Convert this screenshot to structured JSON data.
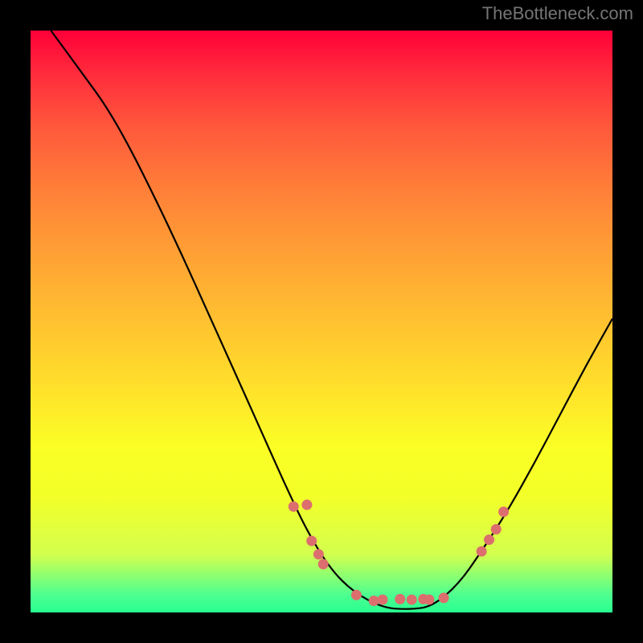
{
  "source_label": "TheBottleneck.com",
  "chart_data": {
    "type": "line",
    "title": "",
    "xlabel": "",
    "ylabel": "",
    "xlim": [
      0,
      100
    ],
    "ylim": [
      0,
      100
    ],
    "curve": [
      {
        "x": 3.5,
        "y": 100
      },
      {
        "x": 9.0,
        "y": 92.5
      },
      {
        "x": 13.0,
        "y": 87.0
      },
      {
        "x": 17.0,
        "y": 80.0
      },
      {
        "x": 21.5,
        "y": 71.0
      },
      {
        "x": 26.0,
        "y": 61.5
      },
      {
        "x": 30.5,
        "y": 51.5
      },
      {
        "x": 35.0,
        "y": 41.5
      },
      {
        "x": 39.5,
        "y": 31.5
      },
      {
        "x": 43.5,
        "y": 22.5
      },
      {
        "x": 47.5,
        "y": 14.0
      },
      {
        "x": 51.5,
        "y": 7.5
      },
      {
        "x": 55.5,
        "y": 3.5
      },
      {
        "x": 60.5,
        "y": 0.8
      },
      {
        "x": 65.0,
        "y": 0.5
      },
      {
        "x": 69.0,
        "y": 1.0
      },
      {
        "x": 73.5,
        "y": 4.8
      },
      {
        "x": 77.5,
        "y": 10.5
      },
      {
        "x": 82.0,
        "y": 17.5
      },
      {
        "x": 86.5,
        "y": 25.5
      },
      {
        "x": 91.0,
        "y": 34.0
      },
      {
        "x": 95.5,
        "y": 42.5
      },
      {
        "x": 100.0,
        "y": 50.5
      }
    ],
    "marker_series": [
      {
        "x": 45.2,
        "y": 18.2
      },
      {
        "x": 47.5,
        "y": 18.5
      },
      {
        "x": 48.3,
        "y": 12.3
      },
      {
        "x": 49.5,
        "y": 10.0
      },
      {
        "x": 50.3,
        "y": 8.3
      },
      {
        "x": 56.0,
        "y": 3.0
      },
      {
        "x": 59.0,
        "y": 2.0
      },
      {
        "x": 60.5,
        "y": 2.2
      },
      {
        "x": 63.5,
        "y": 2.3
      },
      {
        "x": 65.5,
        "y": 2.2
      },
      {
        "x": 67.5,
        "y": 2.3
      },
      {
        "x": 68.5,
        "y": 2.2
      },
      {
        "x": 71.0,
        "y": 2.5
      },
      {
        "x": 77.5,
        "y": 10.5
      },
      {
        "x": 78.8,
        "y": 12.5
      },
      {
        "x": 80.0,
        "y": 14.3
      },
      {
        "x": 81.3,
        "y": 17.3
      }
    ],
    "marker_color": "#dc6e6e",
    "gradient_stops": [
      {
        "pos": 0,
        "color": "#ff0038"
      },
      {
        "pos": 50,
        "color": "#ffd72d"
      },
      {
        "pos": 100,
        "color": "#28ff90"
      }
    ]
  }
}
